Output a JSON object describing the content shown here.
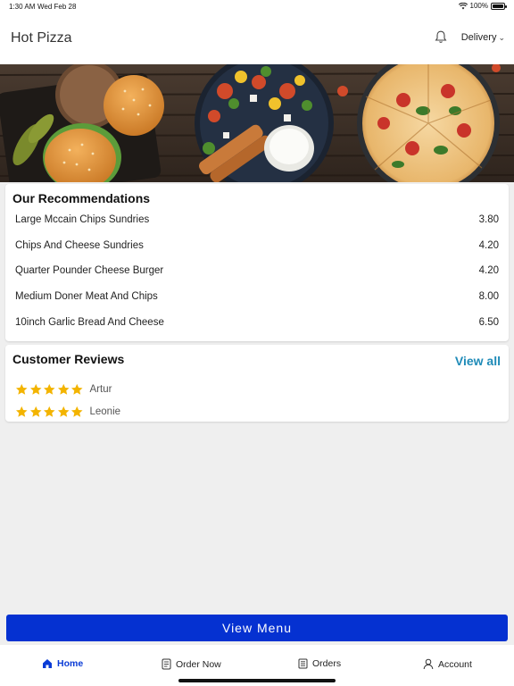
{
  "status_bar": {
    "time": "1:30 AM",
    "date": "Wed Feb 28",
    "battery": "100%"
  },
  "header": {
    "title": "Hot Pizza",
    "delivery_label": "Delivery",
    "icons": {
      "notification": "bell-icon",
      "chevron": "chevron-down-icon"
    }
  },
  "hero": {
    "description_icon": "food-banner-image"
  },
  "recommendations": {
    "title": "Our Recommendations",
    "items": [
      {
        "name": "Large Mccain Chips Sundries",
        "price": "3.80"
      },
      {
        "name": "Chips And Cheese Sundries",
        "price": "4.20"
      },
      {
        "name": "Quarter Pounder Cheese Burger",
        "price": "4.20"
      },
      {
        "name": "Medium Doner Meat And Chips",
        "price": "8.00"
      },
      {
        "name": "10inch Garlic Bread And Cheese",
        "price": "6.50"
      }
    ]
  },
  "reviews": {
    "title": "Customer Reviews",
    "view_all": "View all",
    "items": [
      {
        "name": "Artur",
        "rating": 5
      },
      {
        "name": "Leonie",
        "rating": 5
      }
    ],
    "star_color": "#f3b400"
  },
  "view_menu_label": "View Menu",
  "tabs": [
    {
      "label": "Home",
      "icon": "home-icon",
      "active": true
    },
    {
      "label": "Order Now",
      "icon": "order-icon",
      "active": false
    },
    {
      "label": "Orders",
      "icon": "receipt-icon",
      "active": false
    },
    {
      "label": "Account",
      "icon": "person-icon",
      "active": false
    }
  ],
  "colors": {
    "accent": "#0531d1",
    "link": "#1f8bb8",
    "active_tab": "#0a3bd6"
  }
}
